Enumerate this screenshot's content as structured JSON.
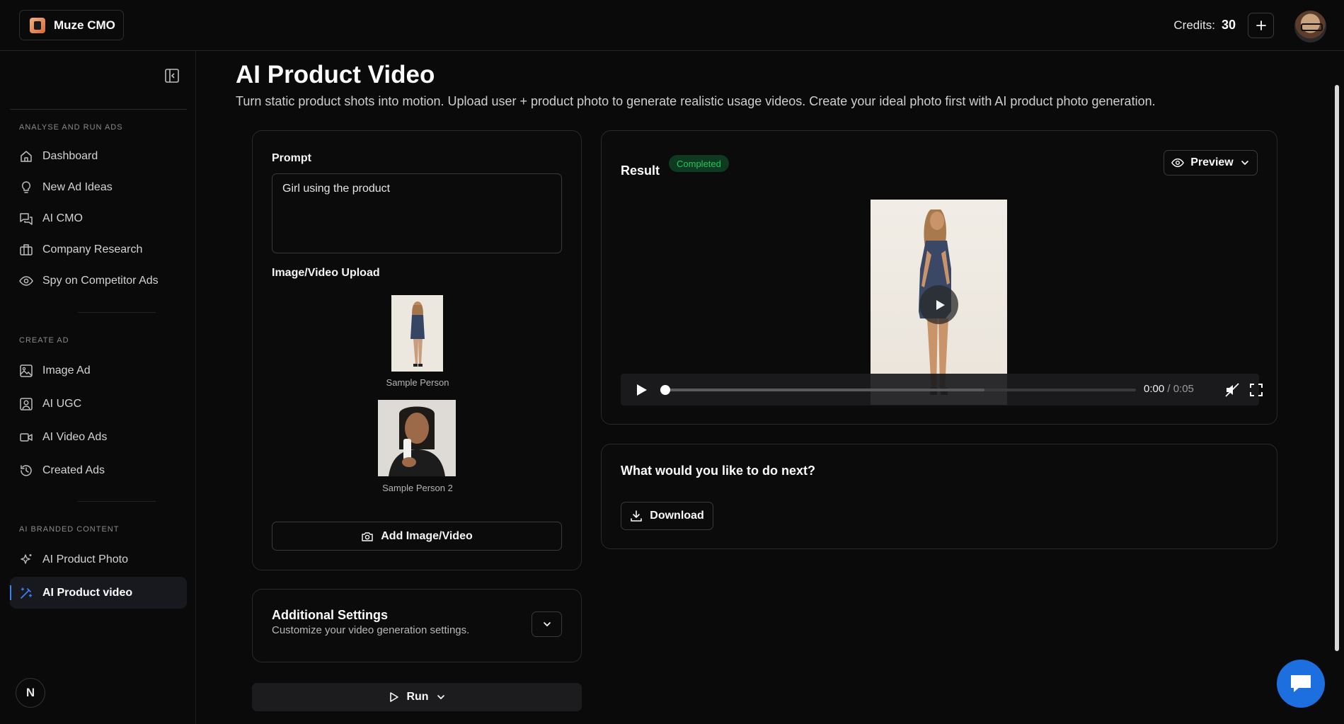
{
  "topbar": {
    "brand_name": "Muze CMO",
    "credits_label": "Credits:",
    "credits_value": "30"
  },
  "sidebar": {
    "sections": [
      {
        "label": "ANALYSE AND RUN ADS"
      },
      {
        "label": "CREATE AD"
      },
      {
        "label": "AI BRANDED CONTENT"
      }
    ],
    "items": [
      {
        "label": "Dashboard",
        "icon": "home-icon"
      },
      {
        "label": "New Ad Ideas",
        "icon": "lightbulb-icon"
      },
      {
        "label": "AI CMO",
        "icon": "chat-icon"
      },
      {
        "label": "Company Research",
        "icon": "briefcase-icon"
      },
      {
        "label": "Spy on Competitor Ads",
        "icon": "eye-icon"
      },
      {
        "label": "Image Ad",
        "icon": "image-icon"
      },
      {
        "label": "AI UGC",
        "icon": "user-square-icon"
      },
      {
        "label": "AI Video Ads",
        "icon": "video-icon"
      },
      {
        "label": "Created Ads",
        "icon": "history-icon"
      },
      {
        "label": "AI Product Photo",
        "icon": "sparkles-icon"
      },
      {
        "label": "AI Product video",
        "icon": "magic-wand-icon",
        "active": true
      }
    ],
    "footer_badge": "N"
  },
  "main": {
    "title": "AI Product Video",
    "subtitle": "Turn static product shots into motion. Upload user + product photo to generate realistic usage videos. Create your ideal photo first with AI product photo generation."
  },
  "input_card": {
    "prompt_label": "Prompt",
    "prompt_value": "Girl using the product",
    "upload_label": "Image/Video Upload",
    "images": [
      {
        "caption": "Sample Person"
      },
      {
        "caption": "Sample Person 2"
      }
    ],
    "add_button": "Add Image/Video"
  },
  "settings_card": {
    "title": "Additional Settings",
    "subtitle": "Customize your video generation settings."
  },
  "run_button": "Run",
  "result_card": {
    "title": "Result",
    "status": "Completed",
    "status_color": "#22c55e",
    "preview_button": "Preview",
    "time_current": "0:00",
    "time_total": "/ 0:05",
    "buffered_fraction": 0.68,
    "played_fraction": 0.0
  },
  "next_card": {
    "title": "What would you like to do next?",
    "download_button": "Download"
  },
  "colors": {
    "accent": "#3b82f6",
    "chat_fab": "#1d6fe0"
  }
}
